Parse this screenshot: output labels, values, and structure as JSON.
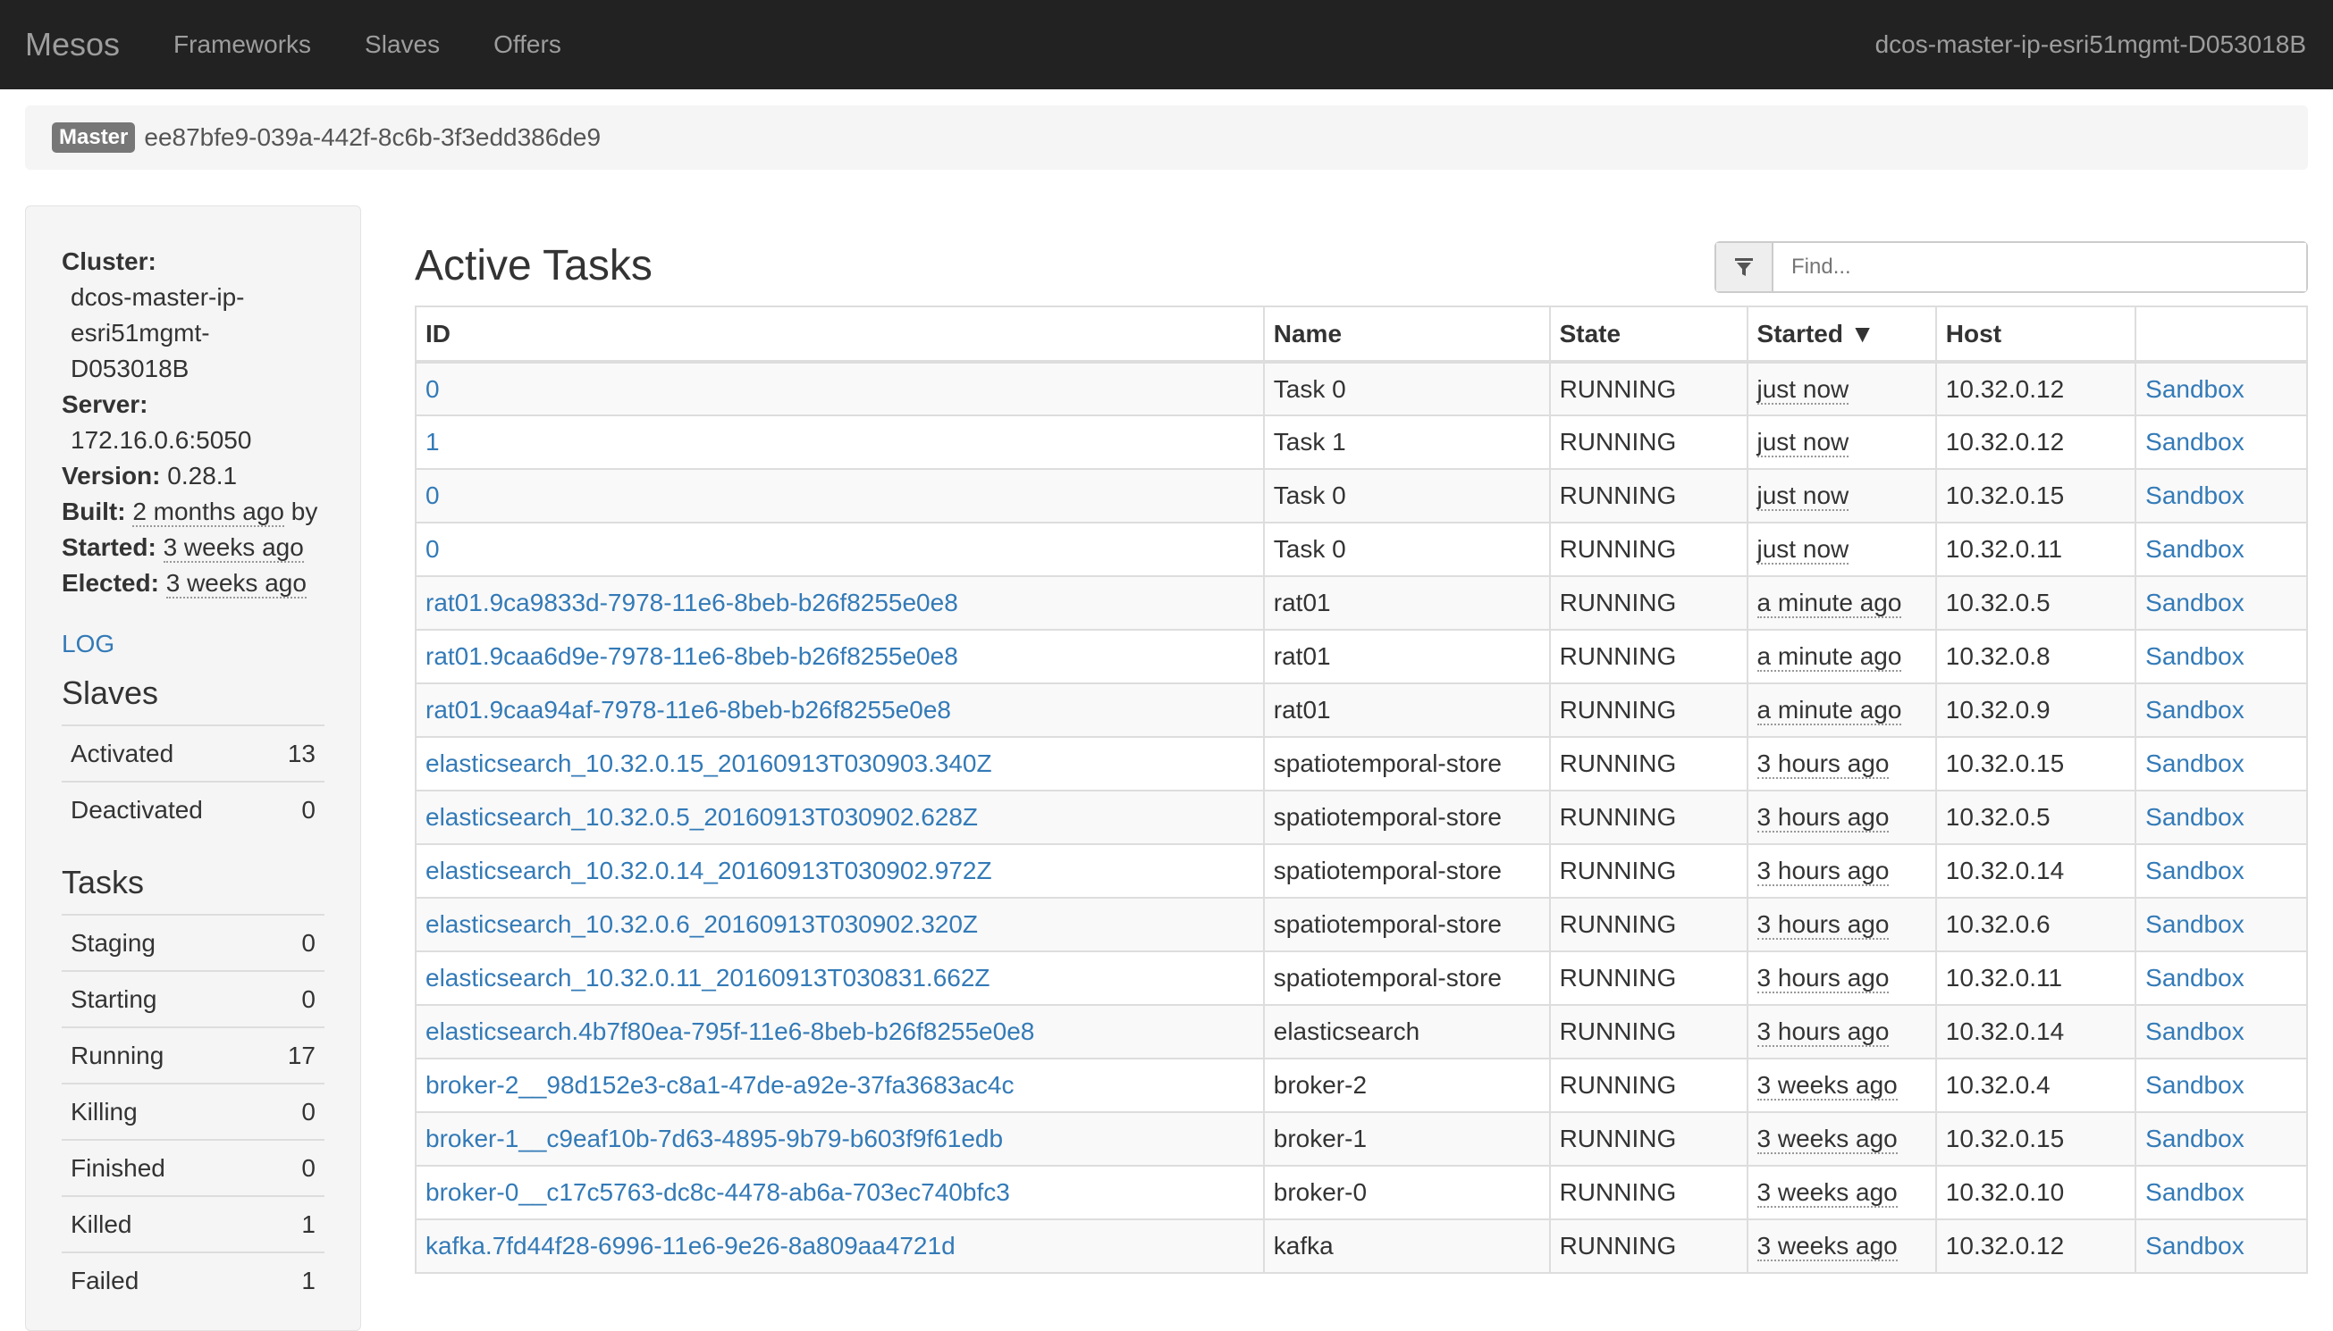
{
  "navbar": {
    "brand": "Mesos",
    "items": [
      "Frameworks",
      "Slaves",
      "Offers"
    ],
    "host": "dcos-master-ip-esri51mgmt-D053018B"
  },
  "master": {
    "badge": "Master",
    "id": "ee87bfe9-039a-442f-8c6b-3f3edd386de9"
  },
  "sidebar": {
    "cluster_label": "Cluster:",
    "cluster_lines": [
      "dcos-master-ip-",
      "esri51mgmt-",
      "D053018B"
    ],
    "server_label": "Server:",
    "server_value": "172.16.0.6:5050",
    "version_label": "Version:",
    "version_value": "0.28.1",
    "built_label": "Built:",
    "built_value": "2 months ago",
    "built_suffix": "by",
    "started_label": "Started:",
    "started_value": "3 weeks ago",
    "elected_label": "Elected:",
    "elected_value": "3 weeks ago",
    "log_label": "LOG",
    "slaves_heading": "Slaves",
    "slaves": [
      {
        "label": "Activated",
        "value": "13"
      },
      {
        "label": "Deactivated",
        "value": "0"
      }
    ],
    "tasks_heading": "Tasks",
    "tasks": [
      {
        "label": "Staging",
        "value": "0"
      },
      {
        "label": "Starting",
        "value": "0"
      },
      {
        "label": "Running",
        "value": "17"
      },
      {
        "label": "Killing",
        "value": "0"
      },
      {
        "label": "Finished",
        "value": "0"
      },
      {
        "label": "Killed",
        "value": "1"
      },
      {
        "label": "Failed",
        "value": "1"
      }
    ]
  },
  "main": {
    "title": "Active Tasks",
    "find_placeholder": "Find...",
    "filter_icon": "filter-icon",
    "columns": [
      "ID",
      "Name",
      "State",
      "Started ▼",
      "Host",
      ""
    ],
    "rows": [
      {
        "id": "0",
        "name": "Task 0",
        "state": "RUNNING",
        "started": "just now",
        "host": "10.32.0.12",
        "sandbox": "Sandbox"
      },
      {
        "id": "1",
        "name": "Task 1",
        "state": "RUNNING",
        "started": "just now",
        "host": "10.32.0.12",
        "sandbox": "Sandbox"
      },
      {
        "id": "0",
        "name": "Task 0",
        "state": "RUNNING",
        "started": "just now",
        "host": "10.32.0.15",
        "sandbox": "Sandbox"
      },
      {
        "id": "0",
        "name": "Task 0",
        "state": "RUNNING",
        "started": "just now",
        "host": "10.32.0.11",
        "sandbox": "Sandbox"
      },
      {
        "id": "rat01.9ca9833d-7978-11e6-8beb-b26f8255e0e8",
        "name": "rat01",
        "state": "RUNNING",
        "started": "a minute ago",
        "host": "10.32.0.5",
        "sandbox": "Sandbox"
      },
      {
        "id": "rat01.9caa6d9e-7978-11e6-8beb-b26f8255e0e8",
        "name": "rat01",
        "state": "RUNNING",
        "started": "a minute ago",
        "host": "10.32.0.8",
        "sandbox": "Sandbox"
      },
      {
        "id": "rat01.9caa94af-7978-11e6-8beb-b26f8255e0e8",
        "name": "rat01",
        "state": "RUNNING",
        "started": "a minute ago",
        "host": "10.32.0.9",
        "sandbox": "Sandbox"
      },
      {
        "id": "elasticsearch_10.32.0.15_20160913T030903.340Z",
        "name": "spatiotemporal-store",
        "state": "RUNNING",
        "started": "3 hours ago",
        "host": "10.32.0.15",
        "sandbox": "Sandbox"
      },
      {
        "id": "elasticsearch_10.32.0.5_20160913T030902.628Z",
        "name": "spatiotemporal-store",
        "state": "RUNNING",
        "started": "3 hours ago",
        "host": "10.32.0.5",
        "sandbox": "Sandbox"
      },
      {
        "id": "elasticsearch_10.32.0.14_20160913T030902.972Z",
        "name": "spatiotemporal-store",
        "state": "RUNNING",
        "started": "3 hours ago",
        "host": "10.32.0.14",
        "sandbox": "Sandbox"
      },
      {
        "id": "elasticsearch_10.32.0.6_20160913T030902.320Z",
        "name": "spatiotemporal-store",
        "state": "RUNNING",
        "started": "3 hours ago",
        "host": "10.32.0.6",
        "sandbox": "Sandbox"
      },
      {
        "id": "elasticsearch_10.32.0.11_20160913T030831.662Z",
        "name": "spatiotemporal-store",
        "state": "RUNNING",
        "started": "3 hours ago",
        "host": "10.32.0.11",
        "sandbox": "Sandbox"
      },
      {
        "id": "elasticsearch.4b7f80ea-795f-11e6-8beb-b26f8255e0e8",
        "name": "elasticsearch",
        "state": "RUNNING",
        "started": "3 hours ago",
        "host": "10.32.0.14",
        "sandbox": "Sandbox"
      },
      {
        "id": "broker-2__98d152e3-c8a1-47de-a92e-37fa3683ac4c",
        "name": "broker-2",
        "state": "RUNNING",
        "started": "3 weeks ago",
        "host": "10.32.0.4",
        "sandbox": "Sandbox"
      },
      {
        "id": "broker-1__c9eaf10b-7d63-4895-9b79-b603f9f61edb",
        "name": "broker-1",
        "state": "RUNNING",
        "started": "3 weeks ago",
        "host": "10.32.0.15",
        "sandbox": "Sandbox"
      },
      {
        "id": "broker-0__c17c5763-dc8c-4478-ab6a-703ec740bfc3",
        "name": "broker-0",
        "state": "RUNNING",
        "started": "3 weeks ago",
        "host": "10.32.0.10",
        "sandbox": "Sandbox"
      },
      {
        "id": "kafka.7fd44f28-6996-11e6-9e26-8a809aa4721d",
        "name": "kafka",
        "state": "RUNNING",
        "started": "3 weeks ago",
        "host": "10.32.0.12",
        "sandbox": "Sandbox"
      }
    ]
  }
}
